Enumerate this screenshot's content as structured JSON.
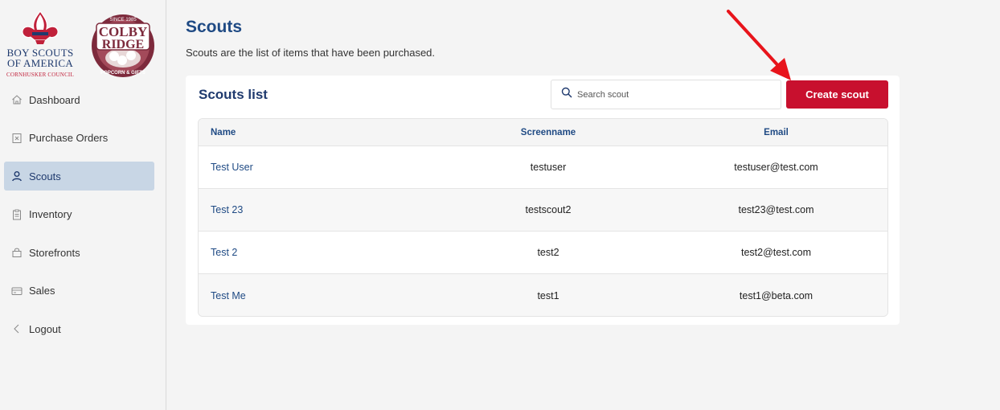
{
  "logos": {
    "bsa": {
      "line1": "BOY SCOUTS",
      "line2": "OF AMERICA",
      "line3": "CORNHUSKER COUNCIL"
    },
    "colby": {
      "top": "SINCE 1985",
      "line1": "COLBY",
      "line2": "RIDGE",
      "bottom": "POPCORN & GIFTS"
    }
  },
  "sidebar": {
    "items": [
      {
        "label": "Dashboard",
        "icon": "home-icon",
        "active": false
      },
      {
        "label": "Purchase Orders",
        "icon": "receipt-icon",
        "active": false
      },
      {
        "label": "Scouts",
        "icon": "user-icon",
        "active": true
      },
      {
        "label": "Inventory",
        "icon": "clipboard-icon",
        "active": false
      },
      {
        "label": "Storefronts",
        "icon": "bag-icon",
        "active": false
      },
      {
        "label": "Sales",
        "icon": "card-icon",
        "active": false
      },
      {
        "label": "Logout",
        "icon": "chevron-left-icon",
        "active": false
      }
    ]
  },
  "header": {
    "title": "Scouts",
    "subtitle": "Scouts are the list of items that have been purchased."
  },
  "card": {
    "title": "Scouts list",
    "search": {
      "placeholder": "Search scout",
      "value": ""
    },
    "create_label": "Create scout"
  },
  "table": {
    "columns": [
      "Name",
      "Screenname",
      "Email"
    ],
    "rows": [
      {
        "name": "Test User",
        "screenname": "testuser",
        "email": "testuser@test.com"
      },
      {
        "name": "Test 23",
        "screenname": "testscout2",
        "email": "test23@test.com"
      },
      {
        "name": "Test 2",
        "screenname": "test2",
        "email": "test2@test.com"
      },
      {
        "name": "Test Me",
        "screenname": "test1",
        "email": "test1@beta.com"
      }
    ]
  },
  "colors": {
    "accent": "#c8102e",
    "primary": "#1f4a84",
    "active_nav": "#c8d6e5",
    "annotation_arrow": "#e8141b"
  }
}
